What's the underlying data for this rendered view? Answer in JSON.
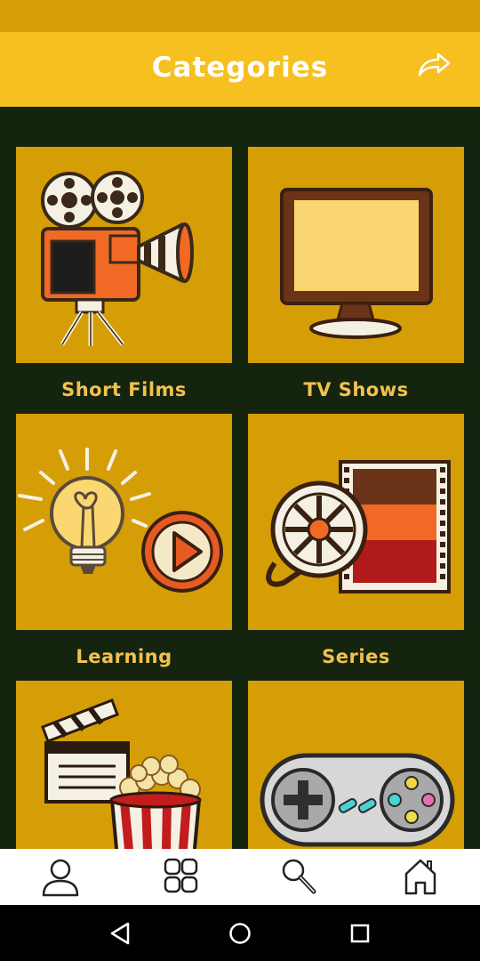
{
  "app_bar": {
    "title": "Categories",
    "share_icon": "share-icon"
  },
  "categories": [
    {
      "label": "Short Films",
      "icon": "film-camera-icon"
    },
    {
      "label": "TV Shows",
      "icon": "tv-icon"
    },
    {
      "label": "Learning",
      "icon": "lightbulb-play-icon"
    },
    {
      "label": "Series",
      "icon": "film-reel-icon"
    },
    {
      "label": "",
      "icon": "clapperboard-popcorn-icon"
    },
    {
      "label": "",
      "icon": "game-controller-icon"
    }
  ],
  "bottom_nav": {
    "items": [
      "profile-icon",
      "grid-icon",
      "search-icon",
      "home-icon"
    ]
  },
  "system_nav": {
    "items": [
      "back-icon",
      "home-circle-icon",
      "recents-icon"
    ]
  },
  "colors": {
    "status_bar": "#d69e06",
    "app_bar": "#f6c020",
    "background": "#14240f",
    "card": "#d69e06",
    "label": "#f2c14e"
  }
}
